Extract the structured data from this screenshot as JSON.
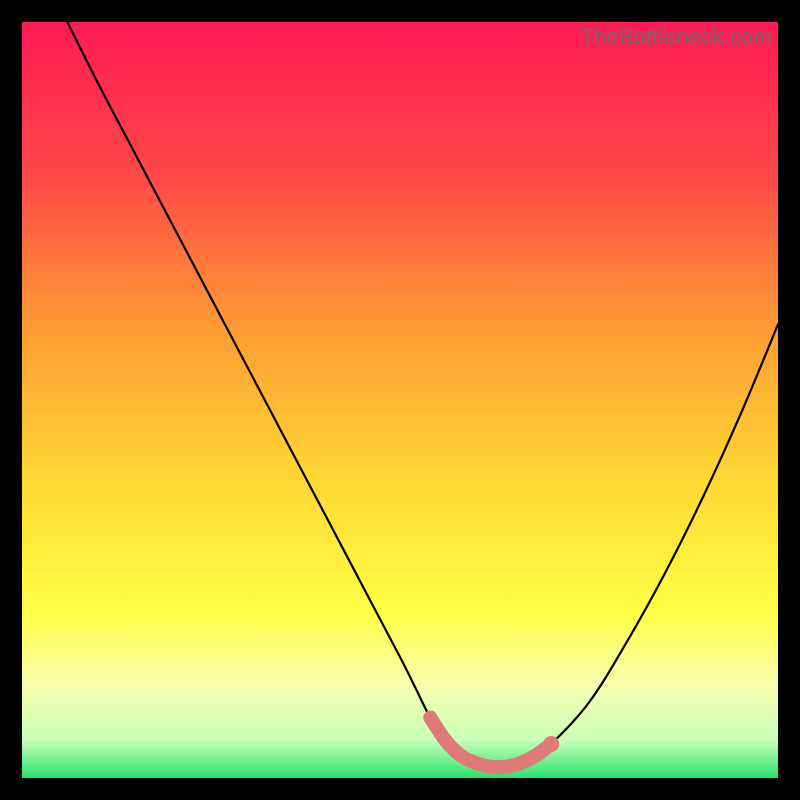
{
  "watermark": "TheBottleneck.com",
  "chart_data": {
    "type": "line",
    "title": "",
    "xlabel": "",
    "ylabel": "",
    "xlim": [
      0,
      100
    ],
    "ylim": [
      0,
      100
    ],
    "series": [
      {
        "name": "curve",
        "x": [
          6,
          10,
          15,
          20,
          25,
          30,
          35,
          40,
          45,
          50,
          52,
          54,
          56,
          58,
          60,
          62,
          64,
          66,
          68,
          70,
          75,
          80,
          85,
          90,
          95,
          100
        ],
        "y": [
          100,
          92,
          82.5,
          73,
          63.5,
          54,
          44.5,
          35,
          25.5,
          16,
          12,
          8,
          5,
          3,
          2,
          1.5,
          1.5,
          2,
          3,
          4.5,
          10,
          18,
          27,
          37,
          48,
          60
        ]
      }
    ],
    "highlight": {
      "name": "plateau",
      "x": [
        54,
        56,
        58,
        60,
        62,
        64,
        66,
        68,
        70
      ],
      "y": [
        8,
        5,
        3,
        2,
        1.5,
        1.5,
        2,
        3,
        4.5
      ]
    },
    "gradient_stops": [
      {
        "pos": 0.0,
        "color": "#ff1a55"
      },
      {
        "pos": 0.2,
        "color": "#ff4747"
      },
      {
        "pos": 0.4,
        "color": "#ff9a33"
      },
      {
        "pos": 0.6,
        "color": "#ffd633"
      },
      {
        "pos": 0.78,
        "color": "#ffff44"
      },
      {
        "pos": 0.88,
        "color": "#f7ffb0"
      },
      {
        "pos": 0.95,
        "color": "#c8ffb8"
      },
      {
        "pos": 1.0,
        "color": "#27e36a"
      }
    ]
  }
}
